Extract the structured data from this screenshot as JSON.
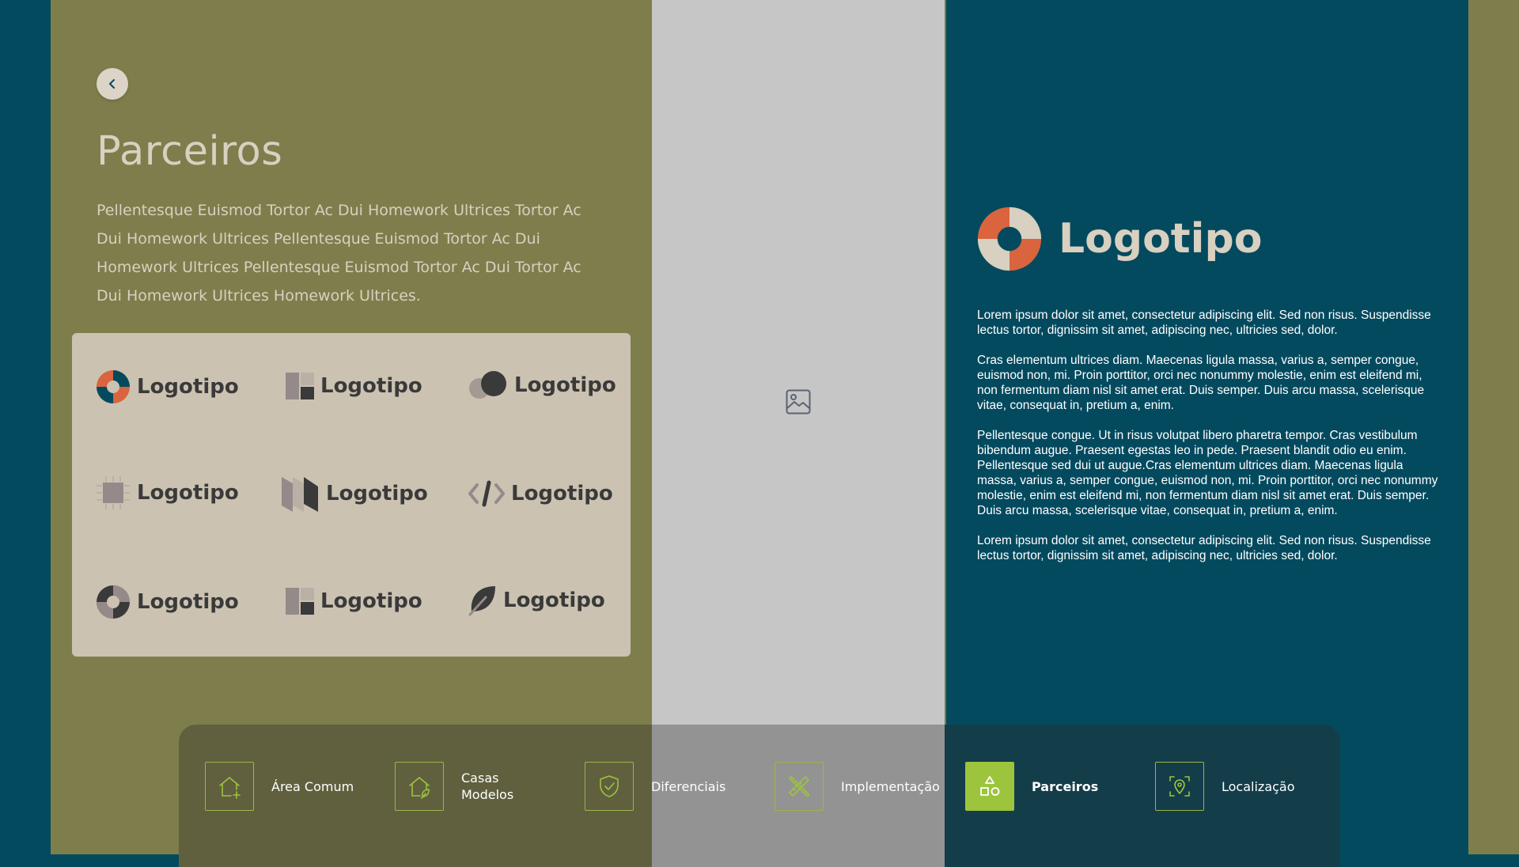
{
  "back_button": {
    "icon": "chevron-left-icon"
  },
  "partners": {
    "title": "Parceiros",
    "intro": "Pellentesque Euismod Tortor Ac Dui Homework Ultrices  Tortor Ac Dui Homework Ultrices  Pellentesque Euismod Tortor Ac Dui Homework Ultrices Pellentesque Euismod Tortor Ac Dui Tortor Ac Dui Homework Ultrices Homework Ultrices."
  },
  "logos": [
    {
      "name": "Logotipo",
      "icon": "orbit-logo-icon"
    },
    {
      "name": "Logotipo",
      "icon": "squares-logo-icon"
    },
    {
      "name": "Logotipo",
      "icon": "speech-bubbles-logo-icon"
    },
    {
      "name": "Logotipo",
      "icon": "chip-logo-icon"
    },
    {
      "name": "Logotipo",
      "icon": "folds-logo-icon"
    },
    {
      "name": "Logotipo",
      "icon": "code-logo-icon"
    },
    {
      "name": "Logotipo",
      "icon": "orbit-gray-logo-icon"
    },
    {
      "name": "Logotipo",
      "icon": "squares-logo-icon"
    },
    {
      "name": "Logotipo",
      "icon": "leaf-logo-icon"
    }
  ],
  "detail": {
    "brand": "Logotipo",
    "paragraphs": [
      "Lorem ipsum dolor sit amet, consectetur adipiscing elit. Sed non risus. Suspendisse lectus tortor, dignissim sit amet, adipiscing nec, ultricies sed, dolor.",
      "Cras elementum ultrices diam. Maecenas ligula massa, varius a, semper congue, euismod non, mi. Proin porttitor, orci nec nonummy molestie, enim est eleifend mi, non fermentum diam nisl sit amet erat. Duis semper. Duis arcu massa, scelerisque vitae, consequat in, pretium a, enim.",
      "Pellentesque congue. Ut in risus volutpat libero pharetra tempor. Cras vestibulum bibendum augue. Praesent egestas leo in pede. Praesent blandit odio eu enim. Pellentesque sed dui ut augue.Cras elementum ultrices diam. Maecenas ligula massa, varius a, semper congue, euismod non, mi. Proin porttitor, orci nec nonummy molestie, enim est eleifend mi, non fermentum diam nisl sit amet erat. Duis semper. Duis arcu massa, scelerisque vitae, consequat in, pretium a, enim.",
      "Lorem ipsum dolor sit amet, consectetur adipiscing elit. Sed non risus. Suspendisse lectus tortor, dignissim sit amet, adipiscing nec, ultricies sed, dolor."
    ]
  },
  "image_placeholder": {
    "icon": "image-icon"
  },
  "nav": {
    "active_index": 4,
    "items": [
      {
        "label": "Área Comum",
        "icon": "house-plus-icon"
      },
      {
        "label": "Casas Modelos",
        "icon": "house-leaf-icon"
      },
      {
        "label": "Diferenciais",
        "icon": "shield-check-icon"
      },
      {
        "label": "Implementação",
        "icon": "pencil-ruler-icon"
      },
      {
        "label": "Parceiros",
        "icon": "shapes-icon"
      },
      {
        "label": "Localização",
        "icon": "map-pin-icon"
      }
    ]
  },
  "colors": {
    "olive": "#7e7e4d",
    "teal": "#044a5f",
    "gray": "#c6c6c6",
    "sand": "#cbc2b1",
    "accent_green": "#9cc43c",
    "brand_orange": "#d9643d"
  }
}
